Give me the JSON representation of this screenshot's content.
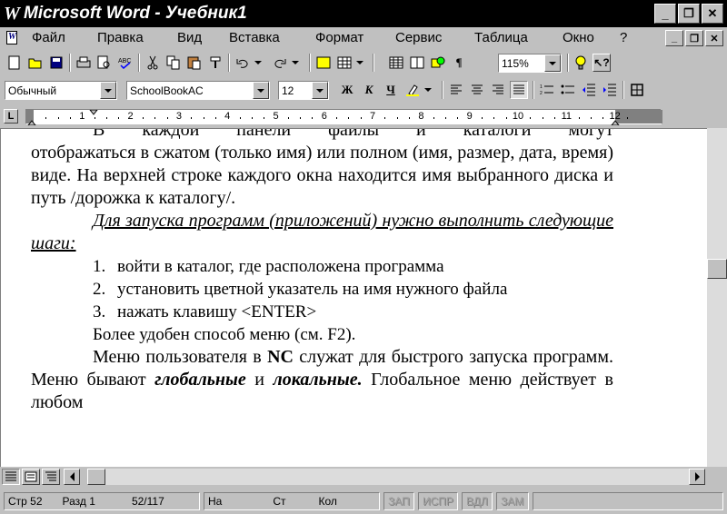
{
  "window": {
    "title": "Microsoft Word - Учебник1",
    "logo_glyph": "W",
    "minimize": "_",
    "restore": "❐",
    "close": "✕"
  },
  "menu": [
    {
      "label": "Файл"
    },
    {
      "label": "Правка"
    },
    {
      "label": "Вид"
    },
    {
      "label": "Вставка"
    },
    {
      "label": "Формат"
    },
    {
      "label": "Сервис"
    },
    {
      "label": "Таблица"
    },
    {
      "label": "Окно"
    },
    {
      "label": "?"
    }
  ],
  "toolbar": {
    "zoom": "115%"
  },
  "format_bar": {
    "style": "Обычный",
    "font": "SchoolBookAC",
    "size": "12",
    "bold": "Ж",
    "italic": "К",
    "underline": "Ч"
  },
  "ruler": {
    "tab_marker": "L",
    "numbers": [
      "1",
      "2",
      "3",
      "4",
      "5",
      "6",
      "7",
      "8",
      "9",
      "10",
      "11",
      "12"
    ]
  },
  "document": {
    "p0_clipped": "В каждой панели файлы и каталоги могут",
    "p0": "отображаться в сжатом (только имя) или полном (имя, размер, дата, время) виде. На верхней строке каждого окна находится имя выбранного диска и путь /дорожка к каталогу/.",
    "p1": "Для запуска программ (приложений) нужно выполнить следующие шаги:",
    "list": [
      {
        "num": "1.",
        "text": "войти в каталог, где расположена программа"
      },
      {
        "num": "2.",
        "text": "установить цветной указатель на имя нужного файла"
      },
      {
        "num": "3.",
        "text": "нажать клавишу <ENTER>"
      }
    ],
    "p2": "Более удобен способ меню (см. F2).",
    "p3_a": "Меню пользователя в ",
    "p3_nc": "NC",
    "p3_b": " служат для быстрого запуска программ. Меню бывают ",
    "p3_global": "глобальные",
    "p3_c": " и ",
    "p3_local": "локальные.",
    "p3_d": " Глобальное меню действует в любом"
  },
  "status": {
    "page": "Стр 52",
    "section": "Разд 1",
    "pages": "52/117",
    "at": "На",
    "line": "Ст",
    "col": "Кол",
    "rec": "ЗАП",
    "trk": "ИСПР",
    "ext": "ВДЛ",
    "ovr": "ЗАМ"
  }
}
